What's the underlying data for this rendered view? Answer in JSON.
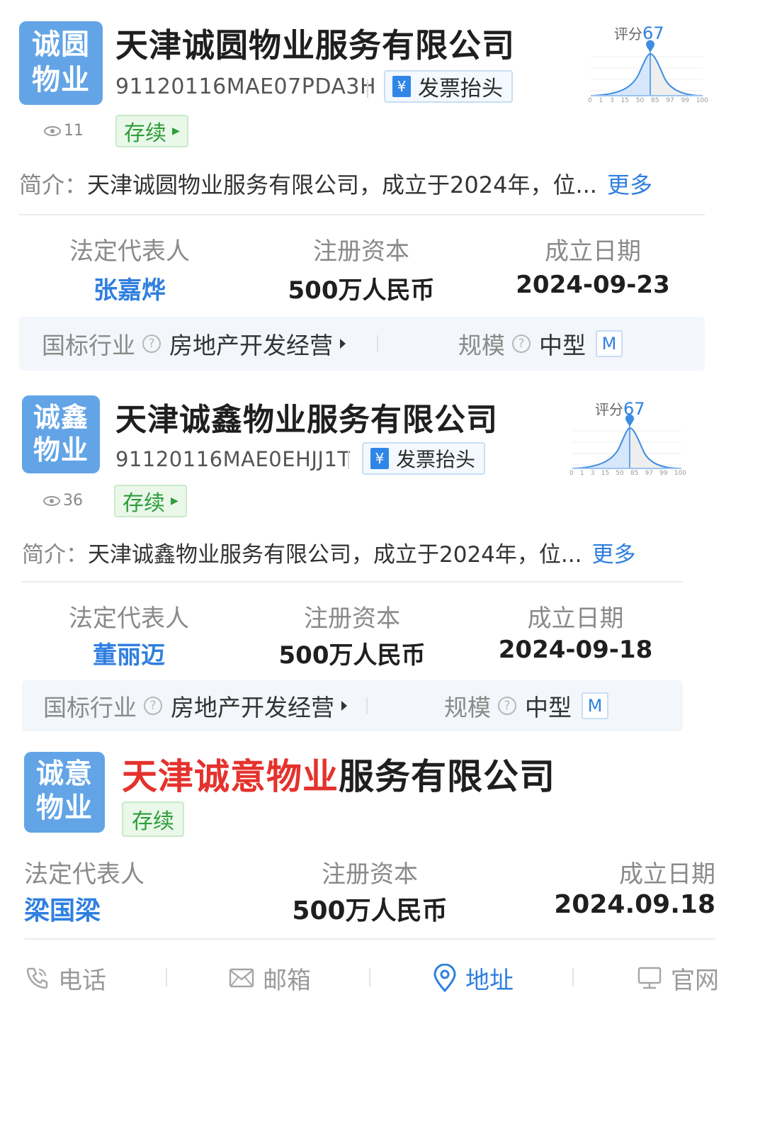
{
  "companies": [
    {
      "logo": [
        "诚圆",
        "物业"
      ],
      "name": "天津诚圆物业服务有限公司",
      "credit_code": "91120116MAE07PDA3H",
      "invoice_label": "发票抬头",
      "views": "11",
      "status": "存续",
      "intro_label": "简介：",
      "intro_text": "天津诚圆物业服务有限公司，成立于2024年，位...",
      "more_label": "更多",
      "score_label": "评分",
      "score": "67",
      "legal_rep_label": "法定代表人",
      "legal_rep": "张嘉烨",
      "capital_label": "注册资本",
      "capital": "500万人民币",
      "date_label": "成立日期",
      "date": "2024-09-23",
      "industry_label": "国标行业",
      "industry": "房地产开发经营",
      "scale_label": "规模",
      "scale": "中型",
      "scale_badge": "M"
    },
    {
      "logo": [
        "诚鑫",
        "物业"
      ],
      "name": "天津诚鑫物业服务有限公司",
      "credit_code": "91120116MAE0EHJJ1T",
      "invoice_label": "发票抬头",
      "views": "36",
      "status": "存续",
      "intro_label": "简介：",
      "intro_text": "天津诚鑫物业服务有限公司，成立于2024年，位...",
      "more_label": "更多",
      "score_label": "评分",
      "score": "67",
      "legal_rep_label": "法定代表人",
      "legal_rep": "董丽迈",
      "capital_label": "注册资本",
      "capital": "500万人民币",
      "date_label": "成立日期",
      "date": "2024-09-18",
      "industry_label": "国标行业",
      "industry": "房地产开发经营",
      "scale_label": "规模",
      "scale": "中型",
      "scale_badge": "M"
    },
    {
      "logo": [
        "诚意",
        "物业"
      ],
      "name_highlight": "天津诚意物业",
      "name_rest": "服务有限公司",
      "status": "存续",
      "legal_rep_label": "法定代表人",
      "legal_rep": "梁国梁",
      "capital_label": "注册资本",
      "capital": "500万人民币",
      "date_label": "成立日期",
      "date": "2024.09.18"
    }
  ],
  "score_axis": [
    "0",
    "1",
    "3",
    "15",
    "50",
    "85",
    "97",
    "99",
    "100"
  ],
  "actions": [
    {
      "label": "电话",
      "icon": "phone-icon"
    },
    {
      "label": "邮箱",
      "icon": "mail-icon"
    },
    {
      "label": "地址",
      "icon": "location-icon",
      "active": true
    },
    {
      "label": "官网",
      "icon": "monitor-icon"
    }
  ],
  "colors": {
    "accent": "#2f7fe0",
    "logo_bg": "#62a4e6",
    "status_green": "#2e9d3a",
    "highlight_red": "#e5322d"
  }
}
